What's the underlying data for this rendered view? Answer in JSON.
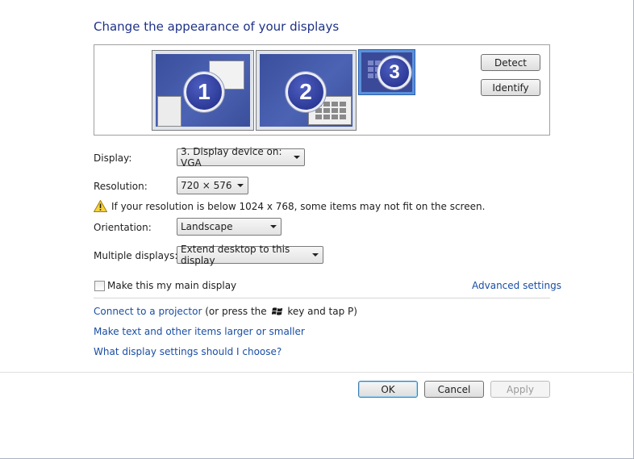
{
  "title": "Change the appearance of your displays",
  "preview": {
    "monitors": [
      {
        "number": "1",
        "selected": false
      },
      {
        "number": "2",
        "selected": false
      },
      {
        "number": "3",
        "selected": true
      }
    ],
    "detect_label": "Detect",
    "identify_label": "Identify"
  },
  "display": {
    "label": "Display:",
    "value": "3. Display device on: VGA"
  },
  "resolution": {
    "label": "Resolution:",
    "value": "720 × 576",
    "warning": "If your resolution is below 1024 x 768, some items may not fit on the screen."
  },
  "orientation": {
    "label": "Orientation:",
    "value": "Landscape"
  },
  "multiple_displays": {
    "label": "Multiple displays:",
    "value": "Extend desktop to this display"
  },
  "main_display": {
    "label": "Make this my main display",
    "checked": false
  },
  "advanced_settings": "Advanced settings",
  "links": {
    "projector": "Connect to a projector",
    "projector_suffix_a": "(or press the",
    "projector_suffix_b": "key and tap P)",
    "text_size": "Make text and other items larger or smaller",
    "help": "What display settings should I choose?"
  },
  "footer": {
    "ok": "OK",
    "cancel": "Cancel",
    "apply": "Apply"
  },
  "icons": {
    "warning": "warning-triangle-icon",
    "windows_key": "windows-logo-icon"
  },
  "colors": {
    "title": "#1e3287",
    "link": "#1a4ea3",
    "selected_monitor": "#5b91d9"
  }
}
